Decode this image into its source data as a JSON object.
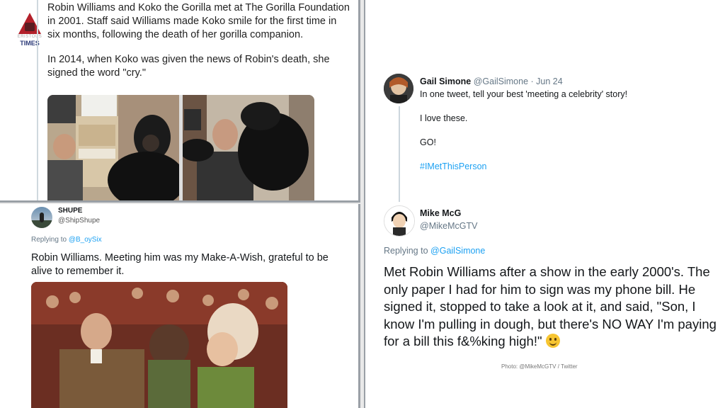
{
  "panel_top": {
    "logo": {
      "subtitle": "ERISTOUS",
      "name": "TIMES"
    },
    "paragraph1": "Robin Williams and Koko the Gorilla met at The Gorilla Foundation in 2001. Staff said Williams made Koko smile for the first time in six months, following the death of her gorilla companion.",
    "paragraph2": "In 2014, when Koko was given the news of Robin's death, she signed the word \"cry.\""
  },
  "panel_bottom": {
    "name": "SHUPE",
    "handle": "@ShipShupe",
    "replying_prefix": "Replying to",
    "replying_to": "@B_oySix",
    "text": "Robin Williams. Meeting him was my Make-A-Wish, grateful to be alive to remember it."
  },
  "panel_right": {
    "tweet1": {
      "name": "Gail Simone",
      "handle_date": "@GailSimone · Jun 24",
      "line1": "In one tweet, tell your best 'meeting a celebrity' story!",
      "line2": "I love these.",
      "line3": "GO!",
      "hashtag": "#IMetThisPerson"
    },
    "tweet2": {
      "name": "Mike McG",
      "handle": "@MikeMcGTV",
      "replying_prefix": "Replying to",
      "replying_to": "@GailSimone",
      "text": "Met Robin Williams after a show in the early 2000's. The only paper I had for him to sign was my phone bill. He signed it, stopped to take a look at it, and said, \"Son, I know I'm pulling in dough, but there's NO WAY I'm paying for a bill this f&%king high!\"",
      "emoji": "slightly-smiling-face"
    },
    "credit": "Photo: @MikeMcGTV / Twitter"
  },
  "colors": {
    "link": "#1da1f2",
    "meta": "#657786",
    "text": "#14171a"
  }
}
